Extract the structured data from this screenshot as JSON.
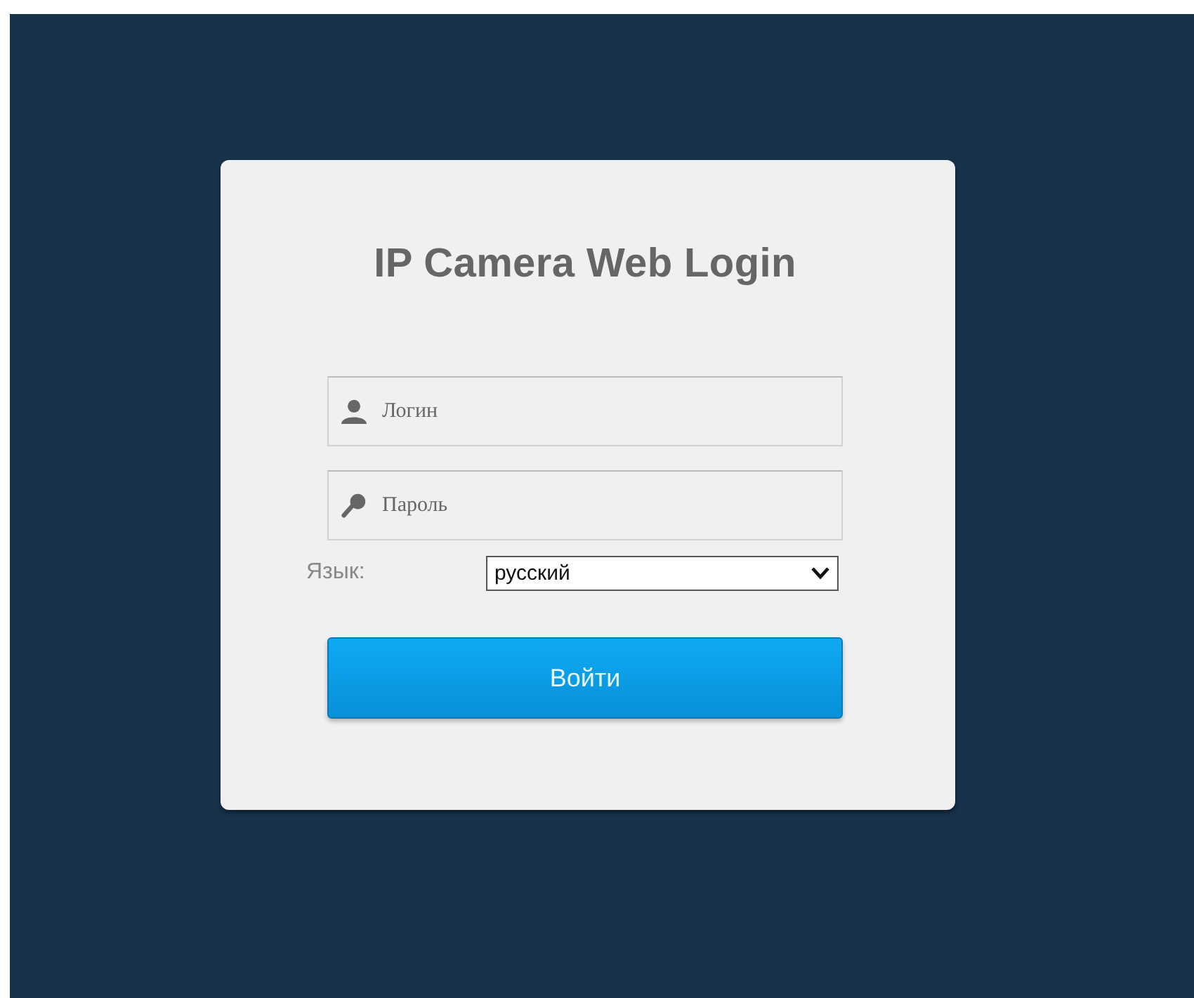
{
  "login_card": {
    "title": "IP Camera Web Login",
    "fields": [
      {
        "kind": "user",
        "placeholder": "Логин"
      },
      {
        "kind": "key",
        "placeholder": "Пароль"
      }
    ],
    "language": {
      "label": "Язык:",
      "value": "русский"
    },
    "submit_button": "Войти"
  }
}
